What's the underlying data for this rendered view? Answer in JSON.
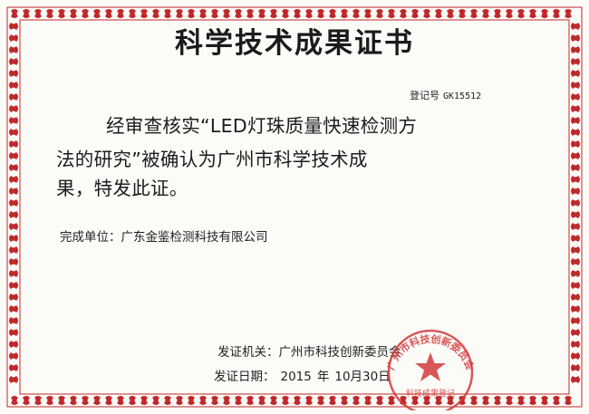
{
  "title": "科学技术成果证书",
  "registration": {
    "label": "登记号",
    "number": "GK15512"
  },
  "body_lines": [
    "经审查核实“LED灯珠质量快速检测方",
    "法的研究”被确认为广州市科学技术成",
    "果，特发此证。"
  ],
  "completing_unit": "完成单位：广东金鉴检测科技有限公司",
  "issuer": "发证机关：广州市科技创新委员会",
  "issue_date": {
    "label": "发证日期：",
    "year": "2015",
    "year_unit": "年",
    "month_day": "10月30日"
  },
  "seal": {
    "outer_text": "广州市科技创新委员会",
    "inner_text": "科技成果登记",
    "color": "#d23a3a"
  },
  "colors": {
    "border": "#c0282a",
    "text": "#1c1c1c",
    "paper": "#fbfbf8"
  }
}
